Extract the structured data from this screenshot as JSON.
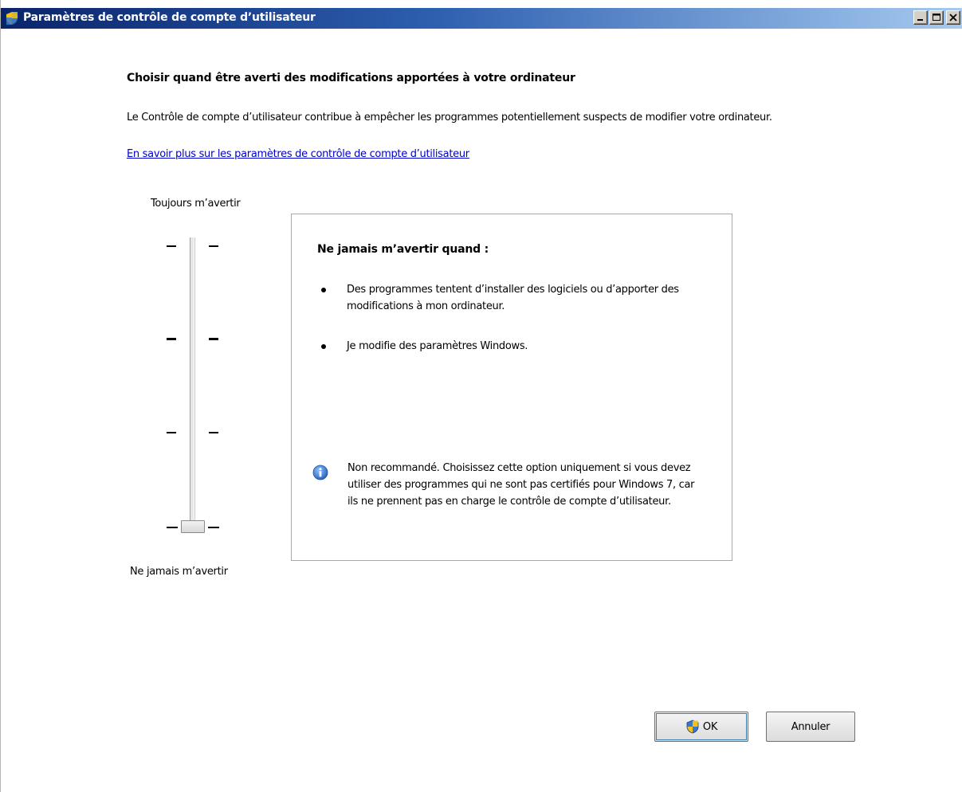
{
  "window": {
    "title": "Paramètres de contrôle de compte d’utilisateur",
    "title_icon": "uac-shield-icon",
    "controls": [
      "minimize-icon",
      "maximize-icon",
      "close-icon"
    ]
  },
  "main": {
    "heading": "Choisir quand être averti des modifications apportées à votre ordinateur",
    "description": "Le Contrôle de compte d’utilisateur contribue à empêcher les programmes potentiellement suspects de modifier votre ordinateur.",
    "learn_more_link": "En savoir plus sur les paramètres de contrôle de compte d’utilisateur"
  },
  "slider": {
    "top_label": "Toujours m’avertir",
    "bottom_label": "Ne jamais m’avertir",
    "levels": 4,
    "selected_level": 1,
    "selected_level_note": "bottom (1 of 4)"
  },
  "info_panel": {
    "title": "Ne jamais m’avertir quand :",
    "bullets": [
      "Des programmes tentent d’installer des logiciels ou d’apporter des modifications à mon ordinateur.",
      "Je modifie des paramètres Windows."
    ],
    "note_icon": "info-icon",
    "note": "Non recommandé. Choisissez cette option uniquement si vous devez utiliser des programmes qui ne sont pas certifiés pour Windows 7, car ils ne prennent pas en charge le contrôle de compte d’utilisateur."
  },
  "buttons": {
    "ok_label": "OK",
    "cancel_label": "Annuler"
  },
  "colors": {
    "titlebar_start": "#0a246a",
    "titlebar_end": "#a6caf0",
    "link": "#0000cc"
  }
}
